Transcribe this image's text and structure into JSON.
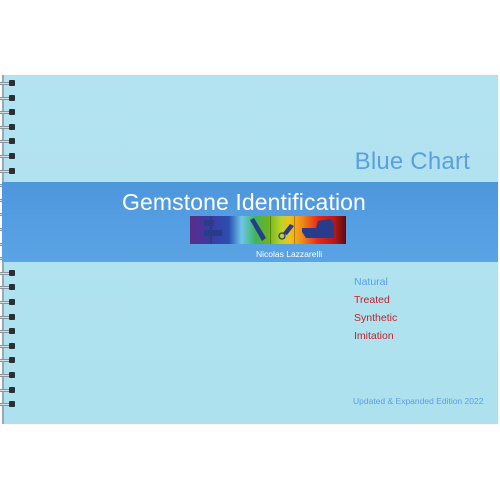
{
  "book": {
    "series_title": "Blue Chart",
    "main_title": "Gemstone Identification",
    "author": "Nicolas Lazzarelli",
    "categories": [
      {
        "label": "Natural",
        "color": "#5b9fe0"
      },
      {
        "label": "Treated",
        "color": "#c8202a"
      },
      {
        "label": "Synthetic",
        "color": "#c8202a"
      },
      {
        "label": "Imitation",
        "color": "#c8202a"
      }
    ],
    "edition": "Updated & Expanded Edition 2022"
  },
  "icons": {
    "strip": "spectrum-gem-instruments-illustration",
    "binding": "spiral-binding-icon"
  },
  "colors": {
    "cover_background": "#b0e2ef",
    "band": "#549ee2",
    "accent_blue": "#5b9fe0",
    "accent_red": "#c8202a",
    "instrument_silhouette": "#283c8c"
  }
}
